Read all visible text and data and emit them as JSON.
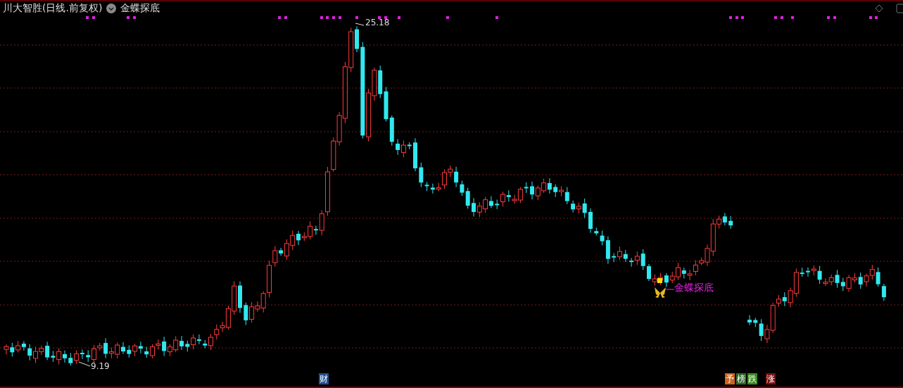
{
  "header": {
    "title": "川大智胜(日线.前复权)",
    "indicator": "金蝶探底"
  },
  "chart": {
    "high_label": "25.18",
    "low_label": "9.19",
    "signal_label": "金蝶探底"
  },
  "markers": [
    {
      "label": "财",
      "color": "#1f4f8f"
    },
    {
      "label": "予",
      "color": "#c8641e"
    },
    {
      "label": "榜",
      "color": "#2f6a2a"
    },
    {
      "label": "跌",
      "color": "#3a8a1e"
    },
    {
      "label": "涨",
      "color": "#7a1010"
    }
  ]
}
